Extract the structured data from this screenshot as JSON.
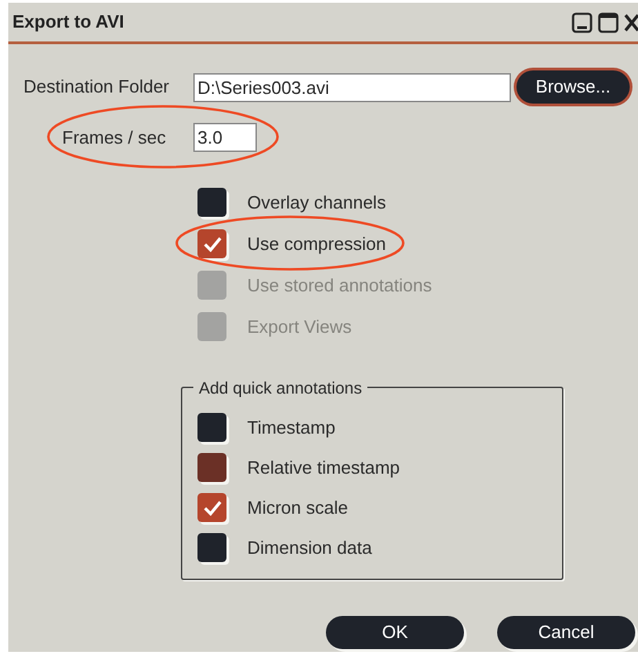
{
  "window": {
    "title": "Export to AVI"
  },
  "destination": {
    "label": "Destination Folder",
    "value": "D:\\Series003.avi",
    "browse": {
      "label": "Browse...",
      "focused": true
    }
  },
  "frames": {
    "label": "Frames / sec",
    "value": "3.0"
  },
  "options": [
    {
      "label": "Overlay channels",
      "checked": false,
      "disabled": false
    },
    {
      "label": "Use compression",
      "checked": true,
      "disabled": false
    },
    {
      "label": "Use stored annotations",
      "checked": false,
      "disabled": true
    },
    {
      "label": "Export Views",
      "checked": false,
      "disabled": true
    }
  ],
  "annotations_group": {
    "title": "Add quick annotations",
    "items": [
      {
        "label": "Timestamp",
        "checked": false,
        "hovered": false
      },
      {
        "label": "Relative timestamp",
        "checked": false,
        "hovered": true
      },
      {
        "label": "Micron scale",
        "checked": true,
        "hovered": false
      },
      {
        "label": "Dimension data",
        "checked": false,
        "hovered": false
      }
    ]
  },
  "buttons": [
    {
      "label": "OK"
    },
    {
      "label": "Cancel"
    }
  ]
}
